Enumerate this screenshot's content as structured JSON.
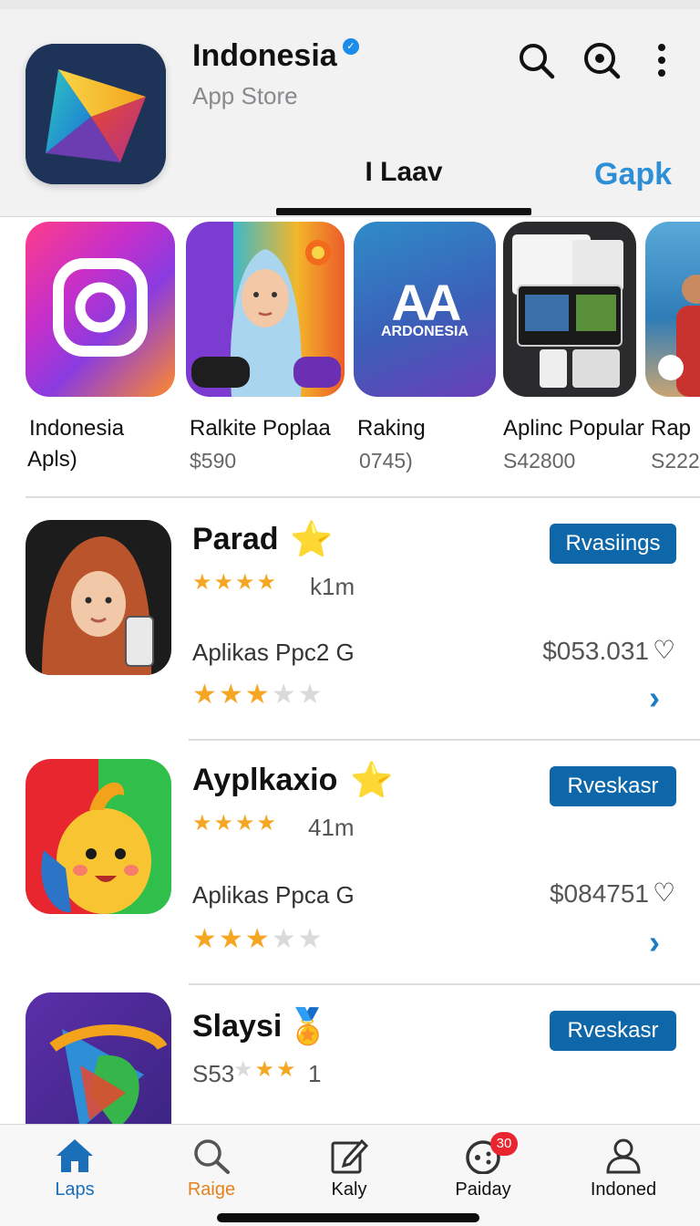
{
  "header": {
    "app_title": "Indonesia",
    "app_subtitle": "App Store",
    "active_tab": "I Laav",
    "right_tab": "Gapk",
    "icons": [
      "search-icon",
      "search-circle-icon",
      "more-vertical-icon"
    ]
  },
  "carousel": {
    "items": [
      {
        "name_line1": "Indonesia",
        "name_line2": "Apls)",
        "price": ""
      },
      {
        "name_line1": "Ralkite Poplaa",
        "name_line2": "",
        "price": "$590"
      },
      {
        "name_line1": "Raking",
        "name_line2": "",
        "price": "0745)",
        "thumb_text": "AA",
        "thumb_caption": "ARDONESIA"
      },
      {
        "name_line1": "Aplinc Popular",
        "name_line2": "",
        "price": "S42800"
      },
      {
        "name_line1": "Rap",
        "name_line2": "",
        "price": "S222"
      }
    ]
  },
  "list": [
    {
      "title": "Parad",
      "badge_emoji": "⭐",
      "rating_count": "k1m",
      "button_label": "Rvasiings",
      "subtitle": "Aplikas Ppc2 G",
      "price": "$053.031",
      "stars": 3
    },
    {
      "title": "Ayplkaxio",
      "badge_emoji": "⭐",
      "rating_count": "41m",
      "button_label": "Rveskasr",
      "subtitle": "Aplikas Ppca G",
      "price": "$084751",
      "stars": 3
    },
    {
      "title": "Slaysi",
      "badge_emoji": "🏅",
      "rating_count": "S53",
      "rating_suffix": "1",
      "button_label": "Rveskasr"
    }
  ],
  "bottom_nav": {
    "items": [
      {
        "label": "Laps",
        "color": "#1a6fb8"
      },
      {
        "label": "Raige",
        "color": "#e3821a"
      },
      {
        "label": "Kaly",
        "color": "#111111"
      },
      {
        "label": "Paiday",
        "color": "#111111",
        "badge": "30"
      },
      {
        "label": "Indoned",
        "color": "#111111"
      }
    ]
  },
  "colors": {
    "accent": "#0d67a8",
    "link_blue": "#2e8fd6",
    "star": "#f5a623",
    "badge_red": "#e8262f"
  }
}
